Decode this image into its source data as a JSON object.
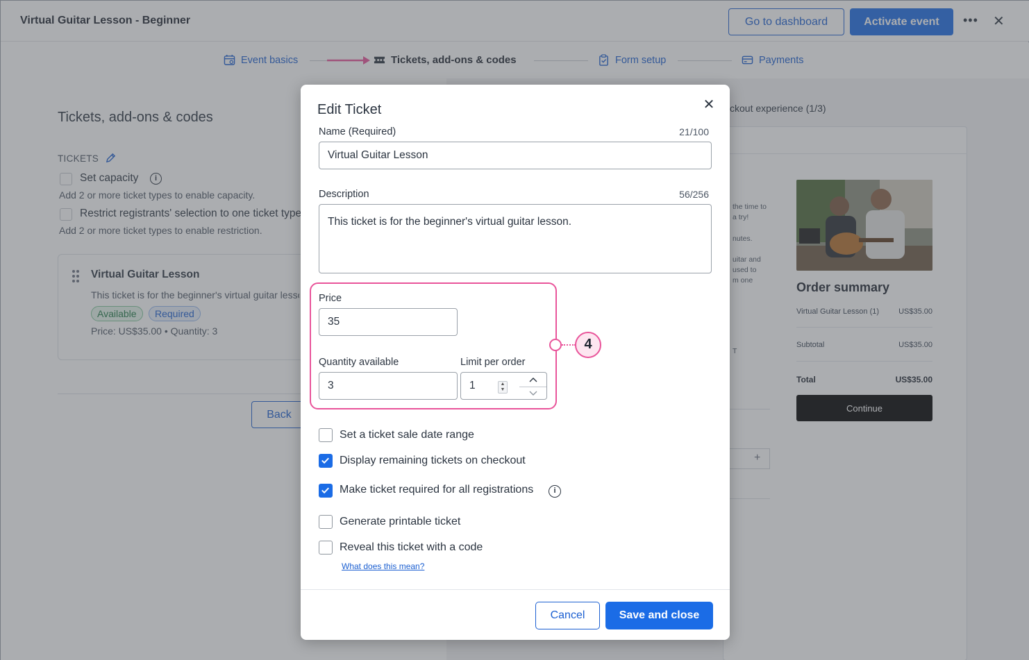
{
  "app": {
    "title": "Virtual Guitar Lesson - Beginner",
    "go_to_dashboard": "Go to dashboard",
    "activate_event": "Activate event",
    "more_icon": "more-horizontal-icon",
    "close_icon": "close-icon"
  },
  "steps": [
    {
      "label": "Event basics",
      "icon": "calendar-star-icon",
      "active": false
    },
    {
      "label": "Tickets, add-ons & codes",
      "icon": "ticket-icon",
      "active": true
    },
    {
      "label": "Form setup",
      "icon": "clipboard-check-icon",
      "active": false
    },
    {
      "label": "Payments",
      "icon": "credit-card-icon",
      "active": false
    }
  ],
  "left": {
    "section_title": "Tickets, add-ons & codes",
    "tickets_label": "TICKETS",
    "set_capacity": "Set capacity",
    "capacity_hint": "Add 2 or more ticket types to enable capacity.",
    "restrict": "Restrict registrants' selection to one ticket type",
    "restrict_hint": "Add 2 or more ticket types to enable restriction.",
    "ticket_card": {
      "title": "Virtual Guitar Lesson",
      "description": "This ticket is for the beginner's virtual guitar lesson.",
      "badge_available": "Available",
      "badge_required": "Required",
      "meta": "Price: US$35.00  •  Quantity: 3"
    },
    "back": "Back"
  },
  "preview": {
    "label": "ckout experience (1/3)",
    "fragments": [
      "the time to",
      "a try!",
      "nutes.",
      "uitar and",
      "used to",
      "m one",
      "T"
    ],
    "order_summary": "Order summary",
    "item_name": "Virtual Guitar Lesson (1)",
    "item_price": "US$35.00",
    "subtotal_label": "Subtotal",
    "subtotal_value": "US$35.00",
    "total_label": "Total",
    "total_value": "US$35.00",
    "continue": "Continue"
  },
  "modal": {
    "title": "Edit Ticket",
    "name_label": "Name",
    "name_required": "(Required)",
    "name_count": "21/100",
    "name_value": "Virtual Guitar Lesson",
    "description_label": "Description",
    "description_count": "56/256",
    "description_value": "This ticket is for the beginner's virtual guitar lesson.",
    "price_label": "Price",
    "price_value": "35",
    "quantity_label": "Quantity available",
    "quantity_value": "3",
    "limit_label": "Limit per order",
    "limit_value": "1",
    "callout_number": "4",
    "checkboxes": [
      {
        "label": "Set a ticket sale date range",
        "checked": false
      },
      {
        "label": "Display remaining tickets on checkout",
        "checked": true
      },
      {
        "label": "Make ticket required for all registrations",
        "checked": true
      },
      {
        "label": "Generate printable ticket",
        "checked": false
      },
      {
        "label": "Reveal this ticket with a code",
        "checked": false
      }
    ],
    "help_link": "What does this mean?",
    "cancel": "Cancel",
    "save": "Save and close"
  },
  "colors": {
    "primary": "#1b6ce6",
    "link": "#1b5fd1",
    "highlight": "#e9549a"
  }
}
